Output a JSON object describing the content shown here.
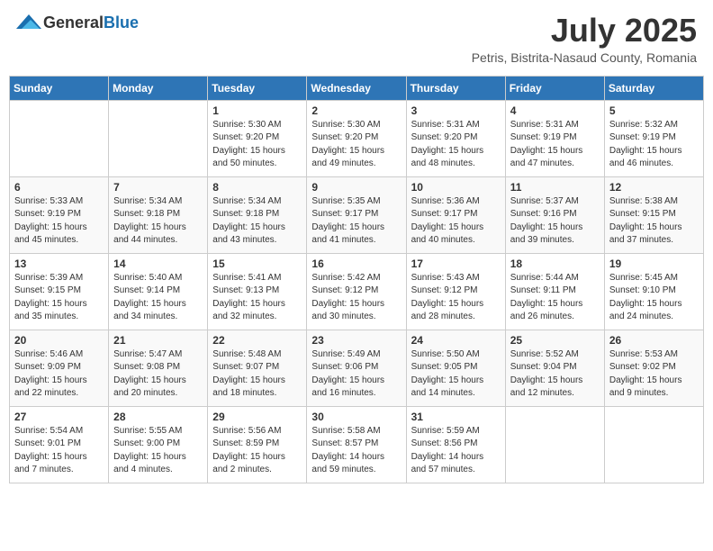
{
  "logo": {
    "general": "General",
    "blue": "Blue"
  },
  "header": {
    "month": "July 2025",
    "location": "Petris, Bistrita-Nasaud County, Romania"
  },
  "weekdays": [
    "Sunday",
    "Monday",
    "Tuesday",
    "Wednesday",
    "Thursday",
    "Friday",
    "Saturday"
  ],
  "weeks": [
    [
      {
        "day": null,
        "sunrise": null,
        "sunset": null,
        "daylight": null
      },
      {
        "day": null,
        "sunrise": null,
        "sunset": null,
        "daylight": null
      },
      {
        "day": "1",
        "sunrise": "Sunrise: 5:30 AM",
        "sunset": "Sunset: 9:20 PM",
        "daylight": "Daylight: 15 hours and 50 minutes."
      },
      {
        "day": "2",
        "sunrise": "Sunrise: 5:30 AM",
        "sunset": "Sunset: 9:20 PM",
        "daylight": "Daylight: 15 hours and 49 minutes."
      },
      {
        "day": "3",
        "sunrise": "Sunrise: 5:31 AM",
        "sunset": "Sunset: 9:20 PM",
        "daylight": "Daylight: 15 hours and 48 minutes."
      },
      {
        "day": "4",
        "sunrise": "Sunrise: 5:31 AM",
        "sunset": "Sunset: 9:19 PM",
        "daylight": "Daylight: 15 hours and 47 minutes."
      },
      {
        "day": "5",
        "sunrise": "Sunrise: 5:32 AM",
        "sunset": "Sunset: 9:19 PM",
        "daylight": "Daylight: 15 hours and 46 minutes."
      }
    ],
    [
      {
        "day": "6",
        "sunrise": "Sunrise: 5:33 AM",
        "sunset": "Sunset: 9:19 PM",
        "daylight": "Daylight: 15 hours and 45 minutes."
      },
      {
        "day": "7",
        "sunrise": "Sunrise: 5:34 AM",
        "sunset": "Sunset: 9:18 PM",
        "daylight": "Daylight: 15 hours and 44 minutes."
      },
      {
        "day": "8",
        "sunrise": "Sunrise: 5:34 AM",
        "sunset": "Sunset: 9:18 PM",
        "daylight": "Daylight: 15 hours and 43 minutes."
      },
      {
        "day": "9",
        "sunrise": "Sunrise: 5:35 AM",
        "sunset": "Sunset: 9:17 PM",
        "daylight": "Daylight: 15 hours and 41 minutes."
      },
      {
        "day": "10",
        "sunrise": "Sunrise: 5:36 AM",
        "sunset": "Sunset: 9:17 PM",
        "daylight": "Daylight: 15 hours and 40 minutes."
      },
      {
        "day": "11",
        "sunrise": "Sunrise: 5:37 AM",
        "sunset": "Sunset: 9:16 PM",
        "daylight": "Daylight: 15 hours and 39 minutes."
      },
      {
        "day": "12",
        "sunrise": "Sunrise: 5:38 AM",
        "sunset": "Sunset: 9:15 PM",
        "daylight": "Daylight: 15 hours and 37 minutes."
      }
    ],
    [
      {
        "day": "13",
        "sunrise": "Sunrise: 5:39 AM",
        "sunset": "Sunset: 9:15 PM",
        "daylight": "Daylight: 15 hours and 35 minutes."
      },
      {
        "day": "14",
        "sunrise": "Sunrise: 5:40 AM",
        "sunset": "Sunset: 9:14 PM",
        "daylight": "Daylight: 15 hours and 34 minutes."
      },
      {
        "day": "15",
        "sunrise": "Sunrise: 5:41 AM",
        "sunset": "Sunset: 9:13 PM",
        "daylight": "Daylight: 15 hours and 32 minutes."
      },
      {
        "day": "16",
        "sunrise": "Sunrise: 5:42 AM",
        "sunset": "Sunset: 9:12 PM",
        "daylight": "Daylight: 15 hours and 30 minutes."
      },
      {
        "day": "17",
        "sunrise": "Sunrise: 5:43 AM",
        "sunset": "Sunset: 9:12 PM",
        "daylight": "Daylight: 15 hours and 28 minutes."
      },
      {
        "day": "18",
        "sunrise": "Sunrise: 5:44 AM",
        "sunset": "Sunset: 9:11 PM",
        "daylight": "Daylight: 15 hours and 26 minutes."
      },
      {
        "day": "19",
        "sunrise": "Sunrise: 5:45 AM",
        "sunset": "Sunset: 9:10 PM",
        "daylight": "Daylight: 15 hours and 24 minutes."
      }
    ],
    [
      {
        "day": "20",
        "sunrise": "Sunrise: 5:46 AM",
        "sunset": "Sunset: 9:09 PM",
        "daylight": "Daylight: 15 hours and 22 minutes."
      },
      {
        "day": "21",
        "sunrise": "Sunrise: 5:47 AM",
        "sunset": "Sunset: 9:08 PM",
        "daylight": "Daylight: 15 hours and 20 minutes."
      },
      {
        "day": "22",
        "sunrise": "Sunrise: 5:48 AM",
        "sunset": "Sunset: 9:07 PM",
        "daylight": "Daylight: 15 hours and 18 minutes."
      },
      {
        "day": "23",
        "sunrise": "Sunrise: 5:49 AM",
        "sunset": "Sunset: 9:06 PM",
        "daylight": "Daylight: 15 hours and 16 minutes."
      },
      {
        "day": "24",
        "sunrise": "Sunrise: 5:50 AM",
        "sunset": "Sunset: 9:05 PM",
        "daylight": "Daylight: 15 hours and 14 minutes."
      },
      {
        "day": "25",
        "sunrise": "Sunrise: 5:52 AM",
        "sunset": "Sunset: 9:04 PM",
        "daylight": "Daylight: 15 hours and 12 minutes."
      },
      {
        "day": "26",
        "sunrise": "Sunrise: 5:53 AM",
        "sunset": "Sunset: 9:02 PM",
        "daylight": "Daylight: 15 hours and 9 minutes."
      }
    ],
    [
      {
        "day": "27",
        "sunrise": "Sunrise: 5:54 AM",
        "sunset": "Sunset: 9:01 PM",
        "daylight": "Daylight: 15 hours and 7 minutes."
      },
      {
        "day": "28",
        "sunrise": "Sunrise: 5:55 AM",
        "sunset": "Sunset: 9:00 PM",
        "daylight": "Daylight: 15 hours and 4 minutes."
      },
      {
        "day": "29",
        "sunrise": "Sunrise: 5:56 AM",
        "sunset": "Sunset: 8:59 PM",
        "daylight": "Daylight: 15 hours and 2 minutes."
      },
      {
        "day": "30",
        "sunrise": "Sunrise: 5:58 AM",
        "sunset": "Sunset: 8:57 PM",
        "daylight": "Daylight: 14 hours and 59 minutes."
      },
      {
        "day": "31",
        "sunrise": "Sunrise: 5:59 AM",
        "sunset": "Sunset: 8:56 PM",
        "daylight": "Daylight: 14 hours and 57 minutes."
      },
      {
        "day": null,
        "sunrise": null,
        "sunset": null,
        "daylight": null
      },
      {
        "day": null,
        "sunrise": null,
        "sunset": null,
        "daylight": null
      }
    ]
  ]
}
